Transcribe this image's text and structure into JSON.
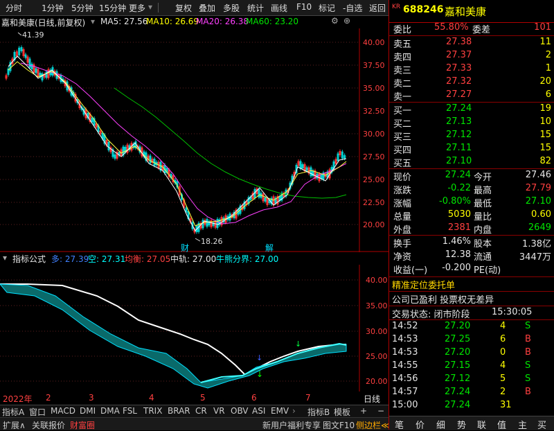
{
  "toolbar": {
    "items": [
      "分时",
      "1分钟",
      "5分钟",
      "15分钟",
      "更多",
      "复权",
      "叠加",
      "多股",
      "统计",
      "画线",
      "F10",
      "标记",
      "-自选",
      "返回"
    ]
  },
  "chart_header": {
    "stock_title": "嘉和美康(日线,前复权)",
    "ma5": "MA5: 27.56",
    "ma10": "MA10: 26.69",
    "ma20": "MA20: 26.38",
    "ma60": "MA60: 23.20"
  },
  "main_chart": {
    "high_label": "41.39",
    "low_label": "18.26",
    "marker_cai": "财",
    "marker_jie": "解",
    "y_ticks": [
      "40.00",
      "37.50",
      "35.00",
      "32.50",
      "30.00",
      "27.50",
      "25.00",
      "22.50",
      "20.00"
    ]
  },
  "indicator_header": {
    "name": "指标公式",
    "duo": "多: 27.39",
    "kong": "空: 27.31",
    "junheng": "均衡: 27.05",
    "zhonggui": "中轨: 27.00",
    "niuxiong": "牛熊分界: 27.00"
  },
  "indicator_chart": {
    "y_ticks": [
      "40.00",
      "35.00",
      "30.00",
      "25.00",
      "20.00"
    ]
  },
  "x_axis": {
    "labels": [
      "2022年",
      "2",
      "3",
      "4",
      "5",
      "6",
      "7"
    ],
    "period": "日线"
  },
  "tabs_row1": [
    "指标A",
    "窗口",
    "MACD",
    "DMI",
    "DMA",
    "FSL",
    "TRIX",
    "BRAR",
    "CR",
    "VR",
    "OBV",
    "ASI",
    "EMV",
    "指标B",
    "模板",
    "+",
    "−"
  ],
  "tabs_row2": {
    "left": [
      "扩展∧",
      "关联报价",
      "财富圈"
    ],
    "right": [
      "新用户福利专享",
      "图文F10",
      "侧边栏≪"
    ]
  },
  "quote": {
    "kr": "KR",
    "code": "688246",
    "name": "嘉和美康",
    "weibi_label": "委比",
    "weibi": "55.80%",
    "weicha_label": "委差",
    "weicha": "101",
    "asks": [
      {
        "label": "卖五",
        "price": "27.38",
        "vol": "11"
      },
      {
        "label": "卖四",
        "price": "27.37",
        "vol": "2"
      },
      {
        "label": "卖三",
        "price": "27.33",
        "vol": "1"
      },
      {
        "label": "卖二",
        "price": "27.32",
        "vol": "20"
      },
      {
        "label": "卖一",
        "price": "27.27",
        "vol": "6"
      }
    ],
    "bids": [
      {
        "label": "买一",
        "price": "27.24",
        "vol": "19"
      },
      {
        "label": "买二",
        "price": "27.13",
        "vol": "10"
      },
      {
        "label": "买三",
        "price": "27.12",
        "vol": "15"
      },
      {
        "label": "买四",
        "price": "27.11",
        "vol": "15"
      },
      {
        "label": "买五",
        "price": "27.10",
        "vol": "82"
      }
    ],
    "stats": [
      {
        "l1": "现价",
        "v1": "27.24",
        "l2": "今开",
        "v2": "27.46"
      },
      {
        "l1": "涨跌",
        "v1": "-0.22",
        "l2": "最高",
        "v2": "27.79"
      },
      {
        "l1": "涨幅",
        "v1": "-0.80%",
        "l2": "最低",
        "v2": "27.10"
      },
      {
        "l1": "总量",
        "v1": "5030",
        "l2": "量比",
        "v2": "0.60"
      },
      {
        "l1": "外盘",
        "v1": "2381",
        "l2": "内盘",
        "v2": "2649"
      }
    ],
    "stats2": [
      {
        "l1": "换手",
        "v1": "1.46%",
        "l2": "股本",
        "v2": "1.38亿"
      },
      {
        "l1": "净资",
        "v1": "12.38",
        "l2": "流通",
        "v2": "3447万"
      },
      {
        "l1": "收益(一)",
        "v1": "-0.200",
        "l2": "PE(动)",
        "v2": ""
      }
    ],
    "promo": "精准定位委托单",
    "info1": "公司已盈利 投票权无差异",
    "status_label": "交易状态: 闭市阶段",
    "status_time": "15:30:05",
    "ticks": [
      {
        "time": "14:52",
        "price": "27.20",
        "vol": "4",
        "dir": "S"
      },
      {
        "time": "14:53",
        "price": "27.25",
        "vol": "6",
        "dir": "B"
      },
      {
        "time": "14:53",
        "price": "27.20",
        "vol": "0",
        "dir": "B"
      },
      {
        "time": "14:55",
        "price": "27.15",
        "vol": "4",
        "dir": "S"
      },
      {
        "time": "14:56",
        "price": "27.12",
        "vol": "5",
        "dir": "S"
      },
      {
        "time": "14:57",
        "price": "27.24",
        "vol": "2",
        "dir": "B"
      },
      {
        "time": "15:00",
        "price": "27.24",
        "vol": "31",
        "dir": ""
      }
    ],
    "bottom_tabs": [
      "笔",
      "价",
      "细",
      "势",
      "联",
      "值",
      "主",
      "买"
    ]
  }
}
